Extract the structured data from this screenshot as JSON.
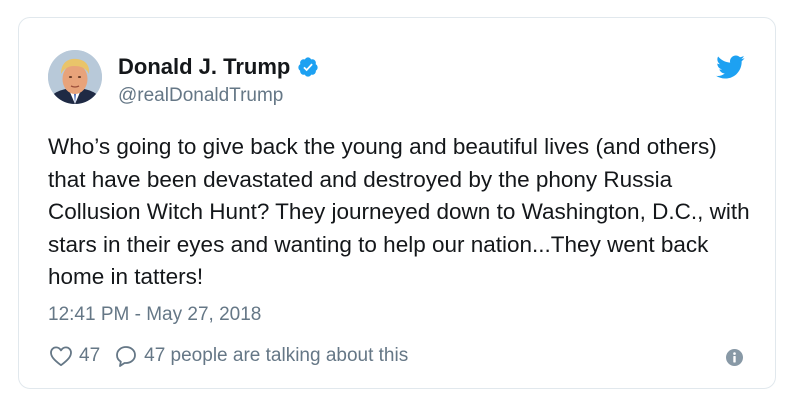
{
  "author": {
    "display_name": "Donald J. Trump",
    "handle": "@realDonaldTrump",
    "verified": true,
    "avatar_icon": "avatar-photo"
  },
  "tweet": {
    "text": "Who’s going to give back the young and beautiful lives (and others) that have been devastated and destroyed by the phony Russia Collusion Witch Hunt? They journeyed down to Washington, D.C., with stars in their eyes and wanting to help our nation...They went back home in tatters!",
    "timestamp": "12:41 PM - May 27, 2018"
  },
  "actions": {
    "like_count": "47",
    "reply_label": "47 people are talking about this"
  },
  "icons": {
    "logo": "twitter-bird-icon",
    "verified": "verified-badge-icon",
    "like": "heart-icon",
    "reply": "speech-bubble-icon",
    "info": "info-icon"
  },
  "colors": {
    "brand": "#1da1f2",
    "text": "#14171a",
    "secondary_text": "#657786",
    "border": "#e1e8ed",
    "info_icon": "#8899a6"
  }
}
